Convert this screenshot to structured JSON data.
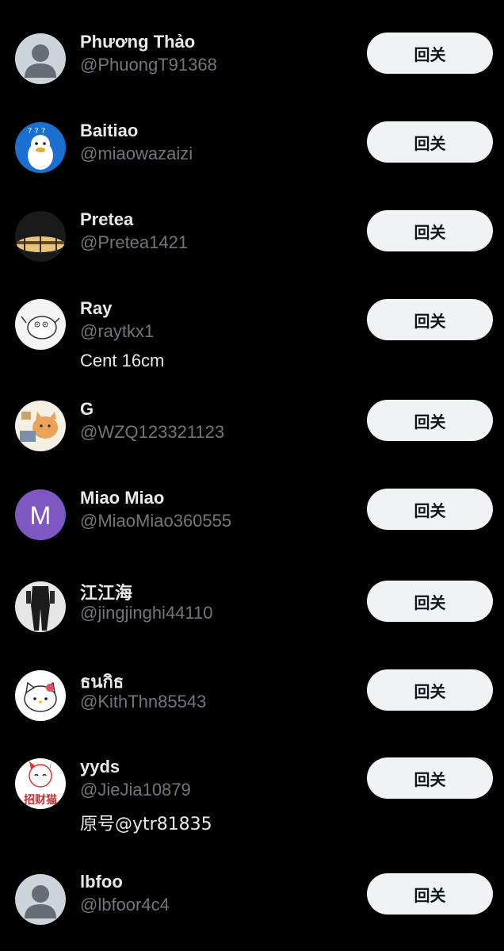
{
  "follow_button_label": "回关",
  "users": [
    {
      "name": "Phương Thảo",
      "handle": "@PhuongT91368",
      "bio": "",
      "avatar": "default-avatar-icon"
    },
    {
      "name": "Baitiao",
      "handle": "@miaowazaizi",
      "bio": "",
      "avatar": "duck-avatar"
    },
    {
      "name": "Pretea",
      "handle": "@Pretea1421",
      "bio": "",
      "avatar": "lamp-avatar"
    },
    {
      "name": "Ray",
      "handle": "@raytkx1",
      "bio": "Cent 16cm",
      "avatar": "sketch-animal-avatar"
    },
    {
      "name": "G",
      "handle": "@WZQ123321123",
      "bio": "",
      "avatar": "cat-avatar"
    },
    {
      "name": "Miao Miao",
      "handle": "@MiaoMiao360555",
      "bio": "",
      "avatar": "letter-m-avatar",
      "avatar_letter": "M",
      "avatar_color": "#7e57c2"
    },
    {
      "name": "江江海",
      "handle": "@jingjinghi44110",
      "bio": "",
      "avatar": "person-photo-avatar"
    },
    {
      "name": "ธนกิธ",
      "handle": "@KithThn85543",
      "bio": "",
      "avatar": "hello-kitty-avatar"
    },
    {
      "name": "yyds",
      "handle": "@JieJia10879",
      "bio": "原号@ytr81835",
      "avatar": "lucky-cat-avatar",
      "avatar_text": "招财猫"
    },
    {
      "name": "lbfoo",
      "handle": "@lbfoor4c4",
      "bio": "",
      "avatar": "default-avatar-icon"
    }
  ]
}
